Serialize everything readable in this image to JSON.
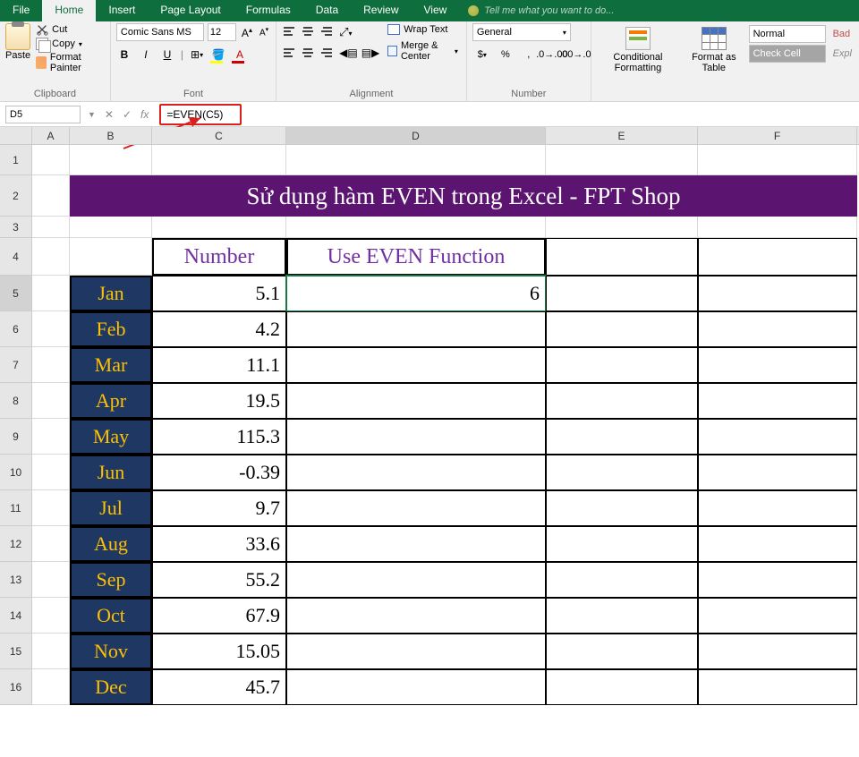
{
  "ribbon": {
    "tabs": [
      "File",
      "Home",
      "Insert",
      "Page Layout",
      "Formulas",
      "Data",
      "Review",
      "View"
    ],
    "active_tab": "Home",
    "tellme": "Tell me what you want to do...",
    "clipboard": {
      "paste": "Paste",
      "cut": "Cut",
      "copy": "Copy",
      "painter": "Format Painter",
      "label": "Clipboard"
    },
    "font": {
      "name": "Comic Sans MS",
      "size": "12",
      "label": "Font"
    },
    "alignment": {
      "wrap": "Wrap Text",
      "merge": "Merge & Center",
      "label": "Alignment"
    },
    "number": {
      "format": "General",
      "label": "Number"
    },
    "styles": {
      "conditional": "Conditional\nFormatting",
      "formatas": "Format as\nTable",
      "normal": "Normal",
      "check": "Check Cell",
      "bad": "Bad",
      "expl": "Expl"
    }
  },
  "formula_bar": {
    "name_box": "D5",
    "formula": "=EVEN(C5)"
  },
  "columns": [
    "A",
    "B",
    "C",
    "D",
    "E",
    "F"
  ],
  "rows": [
    "1",
    "2",
    "3",
    "4",
    "5",
    "6",
    "7",
    "8",
    "9",
    "10",
    "11",
    "12",
    "13",
    "14",
    "15",
    "16"
  ],
  "selected_cell": "D5",
  "sheet": {
    "title": "Sử dụng hàm EVEN trong Excel - FPT Shop",
    "header": {
      "c": "Number",
      "d": "Use EVEN Function"
    },
    "data": [
      {
        "month": "Jan",
        "num": "5.1",
        "even": "6"
      },
      {
        "month": "Feb",
        "num": "4.2",
        "even": ""
      },
      {
        "month": "Mar",
        "num": "11.1",
        "even": ""
      },
      {
        "month": "Apr",
        "num": "19.5",
        "even": ""
      },
      {
        "month": "May",
        "num": "115.3",
        "even": ""
      },
      {
        "month": "Jun",
        "num": "-0.39",
        "even": ""
      },
      {
        "month": "Jul",
        "num": "9.7",
        "even": ""
      },
      {
        "month": "Aug",
        "num": "33.6",
        "even": ""
      },
      {
        "month": "Sep",
        "num": "55.2",
        "even": ""
      },
      {
        "month": "Oct",
        "num": "67.9",
        "even": ""
      },
      {
        "month": "Nov",
        "num": "15.05",
        "even": ""
      },
      {
        "month": "Dec",
        "num": "45.7",
        "even": ""
      }
    ]
  }
}
